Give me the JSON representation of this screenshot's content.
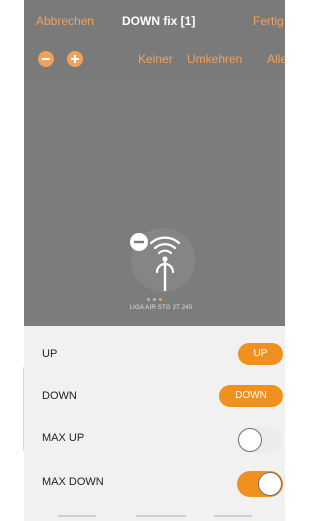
{
  "nav": {
    "cancel": "Abbrechen",
    "title": "DOWN fix [1]",
    "done": "Fertig"
  },
  "toolbar": {
    "none": "Keiner",
    "invert": "Umkehren",
    "all": "Alle"
  },
  "canvas": {
    "device_label": "LIGA AIR STG 2T 240",
    "page_dots": 3
  },
  "rows": [
    {
      "label": "UP",
      "control": "button",
      "button_label": "UP"
    },
    {
      "label": "DOWN",
      "control": "button",
      "button_label": "DOWN"
    },
    {
      "label": "MAX UP",
      "control": "toggle",
      "on": false
    },
    {
      "label": "MAX DOWN",
      "control": "toggle",
      "on": true
    }
  ],
  "colors": {
    "accent": "#f0901f",
    "header_bg": "#7a7a7a",
    "canvas_bg": "#7c7c7c",
    "list_bg": "#f1f1f1"
  }
}
